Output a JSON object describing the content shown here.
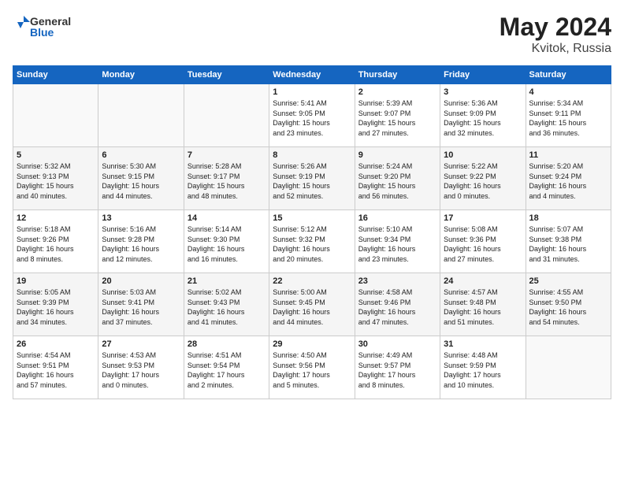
{
  "header": {
    "logo_general": "General",
    "logo_blue": "Blue",
    "title": "May 2024",
    "location": "Kvitok, Russia"
  },
  "weekdays": [
    "Sunday",
    "Monday",
    "Tuesday",
    "Wednesday",
    "Thursday",
    "Friday",
    "Saturday"
  ],
  "weeks": [
    [
      {
        "day": "",
        "info": ""
      },
      {
        "day": "",
        "info": ""
      },
      {
        "day": "",
        "info": ""
      },
      {
        "day": "1",
        "info": "Sunrise: 5:41 AM\nSunset: 9:05 PM\nDaylight: 15 hours\nand 23 minutes."
      },
      {
        "day": "2",
        "info": "Sunrise: 5:39 AM\nSunset: 9:07 PM\nDaylight: 15 hours\nand 27 minutes."
      },
      {
        "day": "3",
        "info": "Sunrise: 5:36 AM\nSunset: 9:09 PM\nDaylight: 15 hours\nand 32 minutes."
      },
      {
        "day": "4",
        "info": "Sunrise: 5:34 AM\nSunset: 9:11 PM\nDaylight: 15 hours\nand 36 minutes."
      }
    ],
    [
      {
        "day": "5",
        "info": "Sunrise: 5:32 AM\nSunset: 9:13 PM\nDaylight: 15 hours\nand 40 minutes."
      },
      {
        "day": "6",
        "info": "Sunrise: 5:30 AM\nSunset: 9:15 PM\nDaylight: 15 hours\nand 44 minutes."
      },
      {
        "day": "7",
        "info": "Sunrise: 5:28 AM\nSunset: 9:17 PM\nDaylight: 15 hours\nand 48 minutes."
      },
      {
        "day": "8",
        "info": "Sunrise: 5:26 AM\nSunset: 9:19 PM\nDaylight: 15 hours\nand 52 minutes."
      },
      {
        "day": "9",
        "info": "Sunrise: 5:24 AM\nSunset: 9:20 PM\nDaylight: 15 hours\nand 56 minutes."
      },
      {
        "day": "10",
        "info": "Sunrise: 5:22 AM\nSunset: 9:22 PM\nDaylight: 16 hours\nand 0 minutes."
      },
      {
        "day": "11",
        "info": "Sunrise: 5:20 AM\nSunset: 9:24 PM\nDaylight: 16 hours\nand 4 minutes."
      }
    ],
    [
      {
        "day": "12",
        "info": "Sunrise: 5:18 AM\nSunset: 9:26 PM\nDaylight: 16 hours\nand 8 minutes."
      },
      {
        "day": "13",
        "info": "Sunrise: 5:16 AM\nSunset: 9:28 PM\nDaylight: 16 hours\nand 12 minutes."
      },
      {
        "day": "14",
        "info": "Sunrise: 5:14 AM\nSunset: 9:30 PM\nDaylight: 16 hours\nand 16 minutes."
      },
      {
        "day": "15",
        "info": "Sunrise: 5:12 AM\nSunset: 9:32 PM\nDaylight: 16 hours\nand 20 minutes."
      },
      {
        "day": "16",
        "info": "Sunrise: 5:10 AM\nSunset: 9:34 PM\nDaylight: 16 hours\nand 23 minutes."
      },
      {
        "day": "17",
        "info": "Sunrise: 5:08 AM\nSunset: 9:36 PM\nDaylight: 16 hours\nand 27 minutes."
      },
      {
        "day": "18",
        "info": "Sunrise: 5:07 AM\nSunset: 9:38 PM\nDaylight: 16 hours\nand 31 minutes."
      }
    ],
    [
      {
        "day": "19",
        "info": "Sunrise: 5:05 AM\nSunset: 9:39 PM\nDaylight: 16 hours\nand 34 minutes."
      },
      {
        "day": "20",
        "info": "Sunrise: 5:03 AM\nSunset: 9:41 PM\nDaylight: 16 hours\nand 37 minutes."
      },
      {
        "day": "21",
        "info": "Sunrise: 5:02 AM\nSunset: 9:43 PM\nDaylight: 16 hours\nand 41 minutes."
      },
      {
        "day": "22",
        "info": "Sunrise: 5:00 AM\nSunset: 9:45 PM\nDaylight: 16 hours\nand 44 minutes."
      },
      {
        "day": "23",
        "info": "Sunrise: 4:58 AM\nSunset: 9:46 PM\nDaylight: 16 hours\nand 47 minutes."
      },
      {
        "day": "24",
        "info": "Sunrise: 4:57 AM\nSunset: 9:48 PM\nDaylight: 16 hours\nand 51 minutes."
      },
      {
        "day": "25",
        "info": "Sunrise: 4:55 AM\nSunset: 9:50 PM\nDaylight: 16 hours\nand 54 minutes."
      }
    ],
    [
      {
        "day": "26",
        "info": "Sunrise: 4:54 AM\nSunset: 9:51 PM\nDaylight: 16 hours\nand 57 minutes."
      },
      {
        "day": "27",
        "info": "Sunrise: 4:53 AM\nSunset: 9:53 PM\nDaylight: 17 hours\nand 0 minutes."
      },
      {
        "day": "28",
        "info": "Sunrise: 4:51 AM\nSunset: 9:54 PM\nDaylight: 17 hours\nand 2 minutes."
      },
      {
        "day": "29",
        "info": "Sunrise: 4:50 AM\nSunset: 9:56 PM\nDaylight: 17 hours\nand 5 minutes."
      },
      {
        "day": "30",
        "info": "Sunrise: 4:49 AM\nSunset: 9:57 PM\nDaylight: 17 hours\nand 8 minutes."
      },
      {
        "day": "31",
        "info": "Sunrise: 4:48 AM\nSunset: 9:59 PM\nDaylight: 17 hours\nand 10 minutes."
      },
      {
        "day": "",
        "info": ""
      }
    ]
  ]
}
